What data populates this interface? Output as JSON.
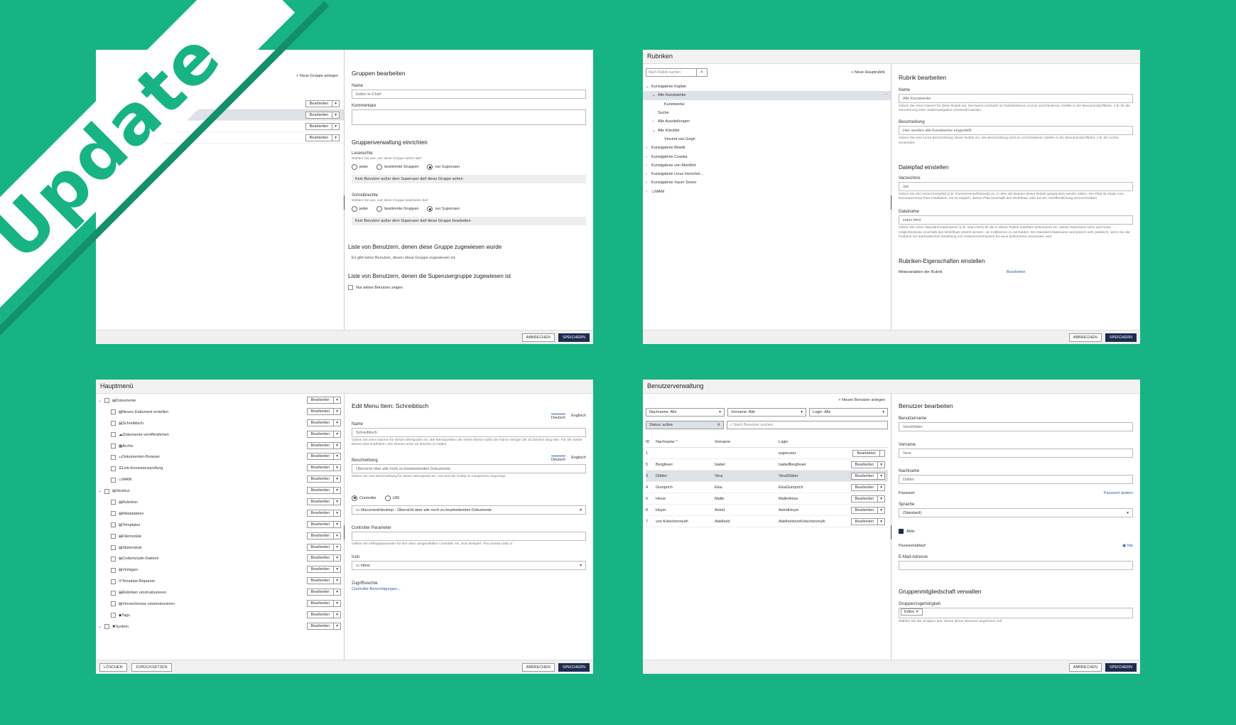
{
  "banner": "Update",
  "w1": {
    "new_group": "+ Neue Gruppe anlegen",
    "rows": [
      {
        "edit": "Bearbeiten"
      },
      {
        "edit": "Bearbeiten"
      },
      {
        "edit": "Bearbeiten"
      },
      {
        "edit": "Bearbeiten"
      }
    ],
    "title": "Gruppen bearbeiten",
    "name_label": "Name",
    "name_value": "Editor-In-Chief",
    "comment_label": "Kommentare",
    "admin_title": "Gruppenverwaltung einrichten",
    "read_label": "Leserechte",
    "read_hint": "Wählen Sie aus, wer diese Gruppe sehen darf",
    "write_label": "Schreibrechte",
    "write_hint": "Wählen Sie aus, wer diese Gruppe bearbeiten darf",
    "opt_all": "jeder",
    "opt_groups": "bestimmte Gruppen",
    "opt_super": "nur Superuser",
    "read_note": "Kein Benutzer außer dem Superuser darf diese Gruppe sehen",
    "write_note": "Kein Benutzer außer dem Superuser darf diese Gruppe bearbeiten",
    "users_title": "Liste von Benutzern, denen diese Gruppe zugewiesen wurde",
    "users_empty": "Es gibt keine Benutzer, denen diese Gruppe zugewiesen ist.",
    "super_title": "Liste von Benutzern, denen die Superusergruppe zugewiesen ist",
    "active_only": "Nur aktive Benutzer zeigen",
    "cancel": "ABBRECHEN",
    "save": "SPEICHERN"
  },
  "w2": {
    "title": "Rubriken",
    "search_placeholder": "Nach Rubrik suchen",
    "new_main": "+ Neue Hauptrubrik",
    "tree": [
      {
        "label": "Kunstgalerie Kaplan",
        "lvl": 0,
        "open": true
      },
      {
        "label": "Alle Kunstwerke",
        "lvl": 1,
        "open": true,
        "sel": true
      },
      {
        "label": "Kunstwerke",
        "lvl": 2
      },
      {
        "label": "Suche",
        "lvl": 1
      },
      {
        "label": "Alle Ausstellungen",
        "lvl": 1,
        "closed": true
      },
      {
        "label": "Alle Künstler",
        "lvl": 1,
        "open": true
      },
      {
        "label": "Vincent van Gogh",
        "lvl": 2
      },
      {
        "label": "Kunstgalerie Binetti",
        "lvl": 0,
        "closed": true
      },
      {
        "label": "Kunstgalerie Czaska",
        "lvl": 0,
        "closed": true
      },
      {
        "label": "Kunstgalerie von Montfort",
        "lvl": 0,
        "closed": true
      },
      {
        "label": "Kunstgalerie Linus Herschel...",
        "lvl": 0,
        "closed": true
      },
      {
        "label": "Kunstgalerie Xaver Seizer",
        "lvl": 0,
        "closed": true
      },
      {
        "label": "MAM",
        "lvl": 0,
        "closed": true
      }
    ],
    "edit_title": "Rubrik bearbeiten",
    "name_label": "Name",
    "name_value": "Alle Kunstwerke",
    "name_hint": "Geben Sie einen Namen für diese Rubrik ein. Der Name erscheint im Rubrikenbaum und an verschiedenen Stellen in der Benutzeroberfläche, z.B. für die Generierung einer Seitennavigation verwendet werden.",
    "desc_label": "Beschreibung",
    "desc_value": "Hier werden alle Kunstwerke eingestellt",
    "desc_hint": "Geben Sie eine kurze Beschreibung dieser Rubrik ein. Die Beschreibung wird an verschiedenen Stellen in der Benutzeroberfläche, z.B. als Archiv, verwendet.",
    "path_title": "Dateipfad einstellen",
    "dir_label": "Verzeichnis",
    "dir_value": "/art",
    "dir_hint": "Geben Sie den Verzeichnispfad (z.B. /home/events/festivals) an, in dem die Dateien dieser Rubrik gespeichert werden sollen. Der Pfad ist relativ zum Document Root Ihrer Installation. Es ist möglich, diesen Pfad innerhalb des Workflows oder bei der Veröffentlichung umzuschreiben.",
    "file_label": "Dateiname",
    "file_value": "index.html",
    "file_hint": "Geben Sie einen Standard-Dateinamen (z.B. index.html) für die in dieser Rubrik erstellten Dokumente ein. Dieser Dateiname kann und muss möglicherweise innerhalb des Workflows ersetzt werden, um Kollisionen zu vermeiden. Ein Standard-Dateiname wird jedoch sehr praktisch, wenn Sie die Funktion zur automatischen Erstellung von Unterverzeichnissen für neue Dokumente verwenden wird.",
    "props_title": "Rubriken-Eigenschaften einstellen",
    "meta_label": "Metavariablen der Rubrik",
    "meta_link": "Bearbeiten",
    "cancel": "ABBRECHEN",
    "save": "SPEICHERN"
  },
  "w3": {
    "title": "Hauptmenü",
    "items": [
      {
        "label": "Dokumente",
        "lvl": 0,
        "open": true
      },
      {
        "label": "Neues Dokument erstellen",
        "lvl": 1
      },
      {
        "label": "Schreibtisch",
        "lvl": 1
      },
      {
        "label": "Dokumente veröffentlichen",
        "lvl": 1
      },
      {
        "label": "Archiv",
        "lvl": 1
      },
      {
        "label": "Dokumenten-Browser",
        "lvl": 1
      },
      {
        "label": "Link-Konsistenzprüfung",
        "lvl": 1
      },
      {
        "label": "MAM",
        "lvl": 1
      },
      {
        "label": "Struktur",
        "lvl": 0,
        "open": true
      },
      {
        "label": "Rubriken",
        "lvl": 1
      },
      {
        "label": "Metadateien",
        "lvl": 1
      },
      {
        "label": "Templates",
        "lvl": 1
      },
      {
        "label": "Filemodule",
        "lvl": 1
      },
      {
        "label": "Slotmodule",
        "lvl": 1
      },
      {
        "label": "Codeinclude-Dateien",
        "lvl": 1
      },
      {
        "label": "Vorlagen",
        "lvl": 1
      },
      {
        "label": "Template-Reparser",
        "lvl": 1
      },
      {
        "label": "Rubriken umstrukturieren",
        "lvl": 1
      },
      {
        "label": "Verzeichnisse umstrukturieren",
        "lvl": 1
      },
      {
        "label": "Tags",
        "lvl": 1
      },
      {
        "label": "System",
        "lvl": 0,
        "open": true
      }
    ],
    "edit": "Bearbeiten",
    "edit_title": "Edit Menu Item: Schreibtisch",
    "lang_de": "Deutsch",
    "lang_en": "Englisch",
    "name_label": "Name",
    "name_value": "Schreibtisch",
    "name_hint": "Geben Sie einen Namen für diesen Menüpunkt ein. Bei Menüpunkten der ersten Ebene sollte der Name weniger als 15 Zeichen lang sein. Für die zweite Ebene wird empfohlen, den Namen unter 25 Zeichen zu halten.",
    "desc_label": "Beschreibung",
    "desc_value": "Übersicht über alle noch zu bearbeitenden Dokumente",
    "desc_hint": "Geben Sie eine Beschreibung für diesen Menüpunkt ein. Sie wird als Tooltip im Hauptmenü angezeigt.",
    "opt_controller": "Controller",
    "opt_uri": "URI",
    "controller_value": "/document/desktop - Übersicht über alle noch zu bearbeitenden Dokumente",
    "param_label": "Controller Parameter",
    "param_hint": "Geben Sie Abfrageparameter für den oben ausgewählten Controller ein. Zum Beispiel: ?foo=bar&a=2&b=3",
    "icon_label": "Icon",
    "icon_value": "inbox",
    "access_label": "Zugriffsrechte",
    "access_link": "Controller-Berechtigungen...",
    "delete": "LÖSCHEN",
    "reset": "ZURÜCKSETZEN",
    "cancel": "ABBRECHEN",
    "save": "SPEICHERN"
  },
  "w4": {
    "title": "Benutzerverwaltung",
    "new_user": "+ Neuen Benutzer anlegen",
    "f_last": "Nachname: Alle",
    "f_first": "Vorname: Alle",
    "f_login": "Login: Alle",
    "f_status": "Status: active",
    "search_placeholder": "Nach Benutzer suchen",
    "col_id": "ID",
    "col_last": "Nachname",
    "col_first": "Vorname",
    "col_login": "Login",
    "users": [
      {
        "id": "1",
        "last": "",
        "first": "",
        "login": "superuser"
      },
      {
        "id": "5",
        "last": "Bergfeuer",
        "first": "Isabel",
        "login": "IsabelBergfeuer"
      },
      {
        "id": "3",
        "last": "Döbler",
        "first": "Vera",
        "login": "VeraDöbler",
        "sel": true
      },
      {
        "id": "4",
        "last": "Gumprich",
        "first": "Elsa",
        "login": "ElsaGumprich"
      },
      {
        "id": "6",
        "last": "Hinse",
        "first": "Malte",
        "login": "MalteHinse"
      },
      {
        "id": "8",
        "last": "Hoyer",
        "first": "Astrid",
        "login": "AstridHoyer"
      },
      {
        "id": "7",
        "last": "von Kotschenreuth",
        "first": "Adelheid",
        "login": "AdelheidvonKotschenreuth"
      }
    ],
    "edit": "Bearbeiten",
    "edit_title": "Benutzer bearbeiten",
    "username_label": "Benutzername",
    "username_value": "VeraDöbler",
    "firstname_label": "Vorname",
    "firstname_value": "Vera",
    "lastname_label": "Nachname",
    "lastname_value": "Döbler",
    "password_label": "Passwort",
    "password_link": "Passwort ändern",
    "lang_label": "Sprache",
    "lang_value": "(Standard)",
    "active_label": "Aktiv",
    "expiry_label": "Passwortablauf",
    "expiry_value": "Nie",
    "email_label": "E-Mail-Adresse",
    "groups_title": "Gruppenmitgliedschaft verwalten",
    "groups_label": "Gruppenzugehörigkeit",
    "group_chip": "Editor",
    "groups_hint": "Wählen Sie die Gruppen aus, denen dieser Benutzer angehören soll",
    "cancel": "ABBRECHEN",
    "save": "SPEICHERN"
  }
}
